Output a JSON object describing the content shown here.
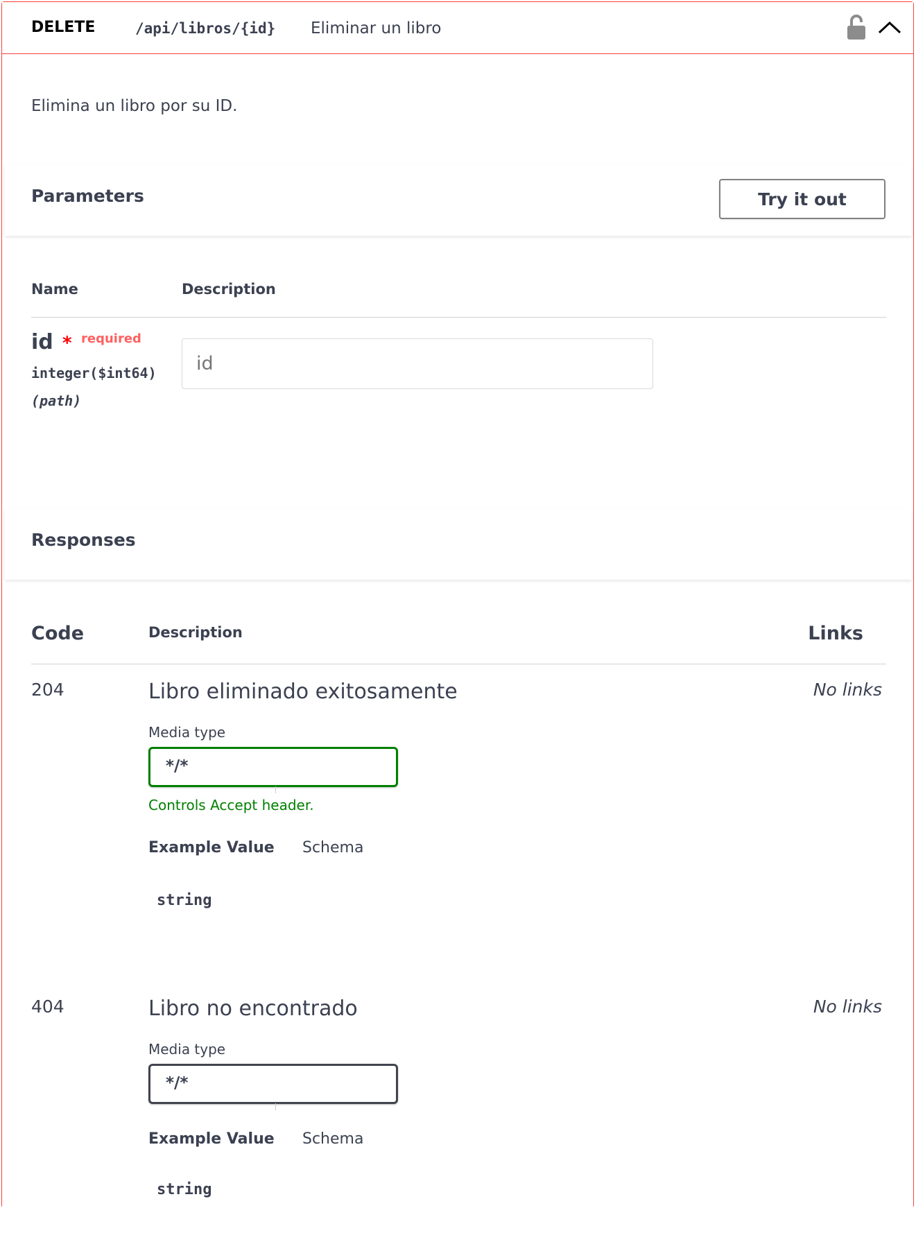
{
  "operation": {
    "method": "DELETE",
    "path": "/api/libros/{id}",
    "summary": "Eliminar un libro",
    "description": "Elimina un libro por su ID.",
    "colors": {
      "delete_accent": "#f93e3e",
      "delete_bg": "#fceded",
      "text": "#3b4151",
      "ok_green": "#008000"
    }
  },
  "parameters": {
    "title": "Parameters",
    "try_button": "Try it out",
    "headers": {
      "name": "Name",
      "description": "Description"
    },
    "items": [
      {
        "name": "id",
        "required_star": "*",
        "required_label": "required",
        "type": "integer($int64)",
        "in": "(path)",
        "placeholder": "id"
      }
    ]
  },
  "responses": {
    "title": "Responses",
    "headers": {
      "code": "Code",
      "description": "Description",
      "links": "Links"
    },
    "items": [
      {
        "code": "204",
        "description": "Libro eliminado exitosamente",
        "links": "No links",
        "media_label": "Media type",
        "media_value": "*/*",
        "accept_note": "Controls Accept header.",
        "tab_example": "Example Value",
        "tab_schema": "Schema",
        "example": "string"
      },
      {
        "code": "404",
        "description": "Libro no encontrado",
        "links": "No links",
        "media_label": "Media type",
        "media_value": "*/*",
        "tab_example": "Example Value",
        "tab_schema": "Schema",
        "example": "string"
      }
    ]
  },
  "icons": {
    "lock": "lock-open-icon",
    "collapse": "chevron-up-icon"
  }
}
